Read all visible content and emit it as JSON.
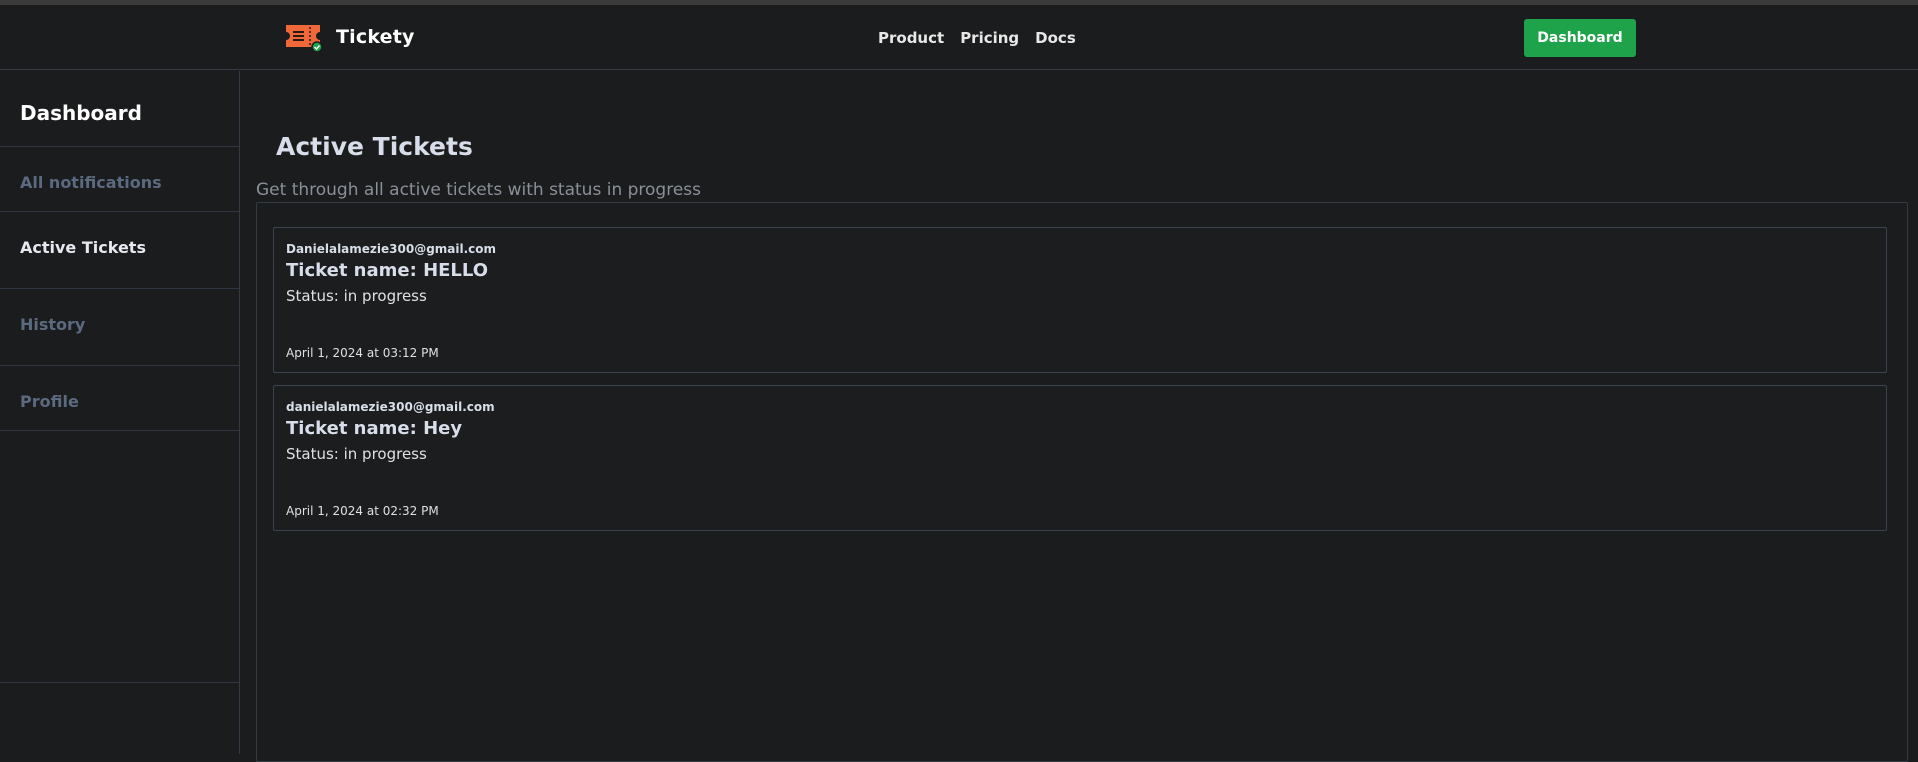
{
  "header": {
    "brand": "Tickety",
    "nav": [
      "Product",
      "Pricing",
      "Docs"
    ],
    "dashboard_button": "Dashboard",
    "accent_color": "#1fa34a",
    "logo_color": "#f0683a"
  },
  "sidebar": {
    "title": "Dashboard",
    "items": [
      {
        "label": "All notifications",
        "active": false
      },
      {
        "label": "Active Tickets",
        "active": true
      },
      {
        "label": "History",
        "active": false
      },
      {
        "label": "Profile",
        "active": false
      }
    ]
  },
  "main": {
    "title": "Active Tickets",
    "subtitle": "Get through all active tickets with status in progress",
    "tickets": [
      {
        "email": "Danielalamezie300@gmail.com",
        "name": "Ticket name: HELLO",
        "status": "Status: in progress",
        "date": "April 1, 2024 at 03:12 PM"
      },
      {
        "email": "danielalamezie300@gmail.com",
        "name": "Ticket name: Hey",
        "status": "Status: in progress",
        "date": "April 1, 2024 at 02:32 PM"
      }
    ]
  }
}
